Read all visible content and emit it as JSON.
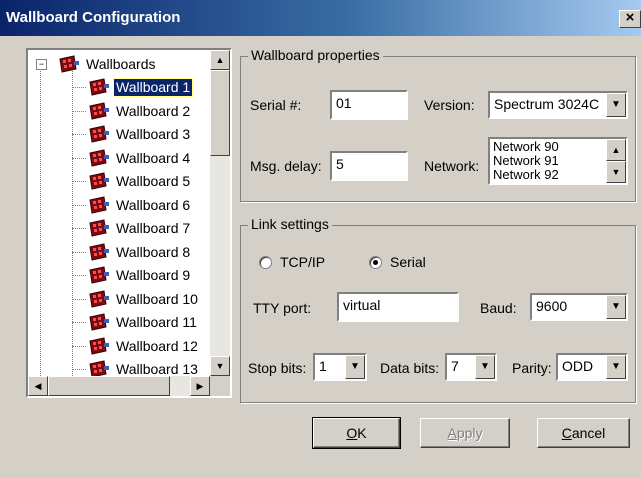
{
  "window": {
    "title": "Wallboard Configuration",
    "close_glyph": "×"
  },
  "tree": {
    "root_label": "Wallboards",
    "expander": "−",
    "icon": "wallboard-icon",
    "items": [
      {
        "label": "Wallboard 1",
        "selected": true
      },
      {
        "label": "Wallboard 2"
      },
      {
        "label": "Wallboard 3"
      },
      {
        "label": "Wallboard 4"
      },
      {
        "label": "Wallboard 5"
      },
      {
        "label": "Wallboard 6"
      },
      {
        "label": "Wallboard 7"
      },
      {
        "label": "Wallboard 8"
      },
      {
        "label": "Wallboard 9"
      },
      {
        "label": "Wallboard 10"
      },
      {
        "label": "Wallboard 11"
      },
      {
        "label": "Wallboard 12"
      },
      {
        "label": "Wallboard 13"
      }
    ]
  },
  "properties": {
    "legend": "Wallboard properties",
    "serial_label": "Serial #:",
    "serial_value": "01",
    "version_label": "Version:",
    "version_value": "Spectrum 3024C",
    "msg_delay_label": "Msg. delay:",
    "msg_delay_value": "5",
    "network_label": "Network:",
    "network_options": [
      "Network 90",
      "Network 91",
      "Network 92"
    ]
  },
  "link": {
    "legend": "Link settings",
    "tcpip_label": "TCP/IP",
    "serial_label": "Serial",
    "selected_mode": "Serial",
    "tty_label": "TTY port:",
    "tty_value": "virtual",
    "baud_label": "Baud:",
    "baud_value": "9600",
    "stop_bits_label": "Stop bits:",
    "stop_bits_value": "1",
    "data_bits_label": "Data bits:",
    "data_bits_value": "7",
    "parity_label": "Parity:",
    "parity_value": "ODD"
  },
  "buttons": {
    "ok_mnemonic": "O",
    "ok_rest": "K",
    "apply_mnemonic": "A",
    "apply_rest": "pply",
    "cancel_mnemonic": "C",
    "cancel_rest": "ancel"
  },
  "colors": {
    "selection": "#0a246a",
    "dialog_bg": "#d4d0c8",
    "title_start": "#0a246a",
    "title_end": "#a6caf0"
  }
}
